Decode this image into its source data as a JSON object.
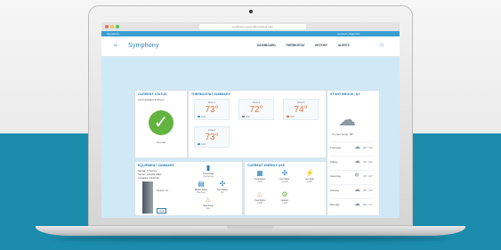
{
  "browser": {
    "url": "symphony.mysymphonyhome.com",
    "tab_label": "Symphony",
    "tab_right": "Account  |  Sign Out"
  },
  "header": {
    "logo_text": "Symphony",
    "nav": [
      "DASHBOARD",
      "THERMOSTAT",
      "HISTORY",
      "ALERTS"
    ]
  },
  "current_status": {
    "title": "CURRENT STATUS",
    "subtitle": "Last Updated 3:50 pm",
    "status_label": "Normal"
  },
  "thermostat": {
    "title": "THERMOSTAT SUMMARY",
    "zones": [
      {
        "label": "Zone 1",
        "temp": "73°",
        "mode": "Cool"
      },
      {
        "label": "Zone 2",
        "temp": "72°",
        "mode": "Auto"
      },
      {
        "label": "Zone 3",
        "temp": "74°",
        "mode": "Heat"
      },
      {
        "label": "Zone 4",
        "temp": "73°",
        "mode": "Cool"
      }
    ]
  },
  "weather": {
    "title": "STONY BROOK, NY",
    "current_label": "Current Temp: 28°",
    "forecast": [
      {
        "day": "Thursday",
        "temp": "28° / 18°"
      },
      {
        "day": "Friday",
        "temp": "30° / 20°"
      },
      {
        "day": "Saturday",
        "temp": "33° / 22°"
      },
      {
        "day": "Sunday",
        "temp": "31° / 19°"
      },
      {
        "day": "Monday",
        "temp": "29° / 17°"
      }
    ]
  },
  "equipment": {
    "title": "EQUIPMENT SUMMARY",
    "lines": [
      "Model: X Series",
      "Serial: 1234567890",
      "Installed: 01/2015"
    ],
    "items": [
      {
        "label": "Thermostat",
        "value": "Connected"
      },
      {
        "label": "Blower Motor",
        "value": "Running"
      },
      {
        "label": "Fan Status",
        "value": "On"
      },
      {
        "label": "Heat Pump",
        "value": "Idle"
      }
    ],
    "callouts": [
      "Return Air",
      "Unit"
    ]
  },
  "energy": {
    "title": "CURRENT ENERGY USE",
    "items": [
      {
        "label": "Compressor",
        "value": "2 kW"
      },
      {
        "label": "Fan Motor",
        "value": "0.3 kW"
      },
      {
        "label": "Aux Heat",
        "value": "0 kW"
      },
      {
        "label": "Heat Strips",
        "value": "0 kW"
      },
      {
        "label": "Outdoor",
        "value": "1 kW"
      }
    ]
  },
  "colors": {
    "brand": "#2b7fb5",
    "accent_temp": "#e1773f",
    "ok_green": "#62b33f",
    "band": "#1b8cab"
  }
}
